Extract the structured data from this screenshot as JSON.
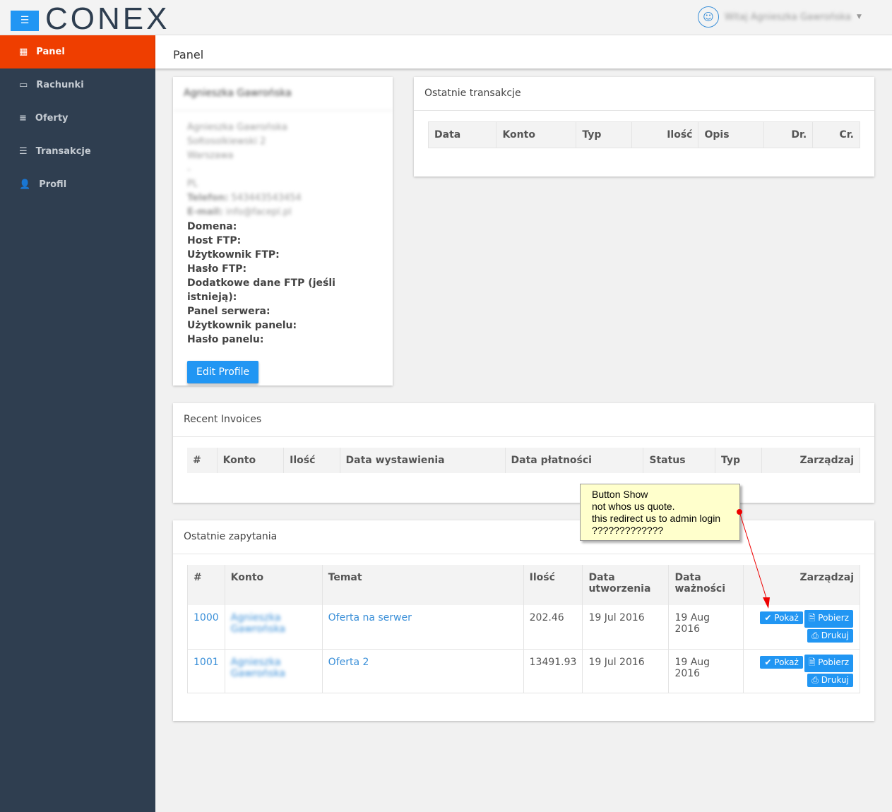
{
  "brand": "CONEX",
  "header": {
    "greeting": "Witaj Agnieszka Gawrońska"
  },
  "sidebar": {
    "items": [
      {
        "label": "Panel",
        "icon": "grid-icon"
      },
      {
        "label": "Rachunki",
        "icon": "card-icon"
      },
      {
        "label": "Oferty",
        "icon": "list-icon"
      },
      {
        "label": "Transakcje",
        "icon": "database-icon"
      },
      {
        "label": "Profil",
        "icon": "user-icon"
      }
    ]
  },
  "page_title": "Panel",
  "profile": {
    "name": "Agnieszka Gawrońska",
    "address": [
      "Agnieszka Gawrońska",
      "Sołtosolkiewski 2",
      "Warszawa",
      "-",
      "PL"
    ],
    "phone_label": "Telefon:",
    "phone": "543443543454",
    "email_label": "E-mail:",
    "email": "info@facepl.pl",
    "fields": [
      "Domena:",
      "Host FTP:",
      "Użytkownik FTP:",
      "Hasło FTP:",
      "Dodatkowe dane FTP (jeśli istnieją):",
      "Panel serwera:",
      "Użytkownik panelu:",
      "Hasło panelu:"
    ],
    "edit_button": "Edit Profile"
  },
  "transactions": {
    "title": "Ostatnie transakcje",
    "columns": [
      "Data",
      "Konto",
      "Typ",
      "Ilość",
      "Opis",
      "Dr.",
      "Cr."
    ]
  },
  "invoices": {
    "title": "Recent Invoices",
    "columns": [
      "#",
      "Konto",
      "Ilość",
      "Data wystawienia",
      "Data płatności",
      "Status",
      "Typ",
      "Zarządzaj"
    ]
  },
  "quotes": {
    "title": "Ostatnie zapytania",
    "columns": [
      "#",
      "Konto",
      "Temat",
      "Ilość",
      "Data utworzenia",
      "Data ważności",
      "Zarządzaj"
    ],
    "rows": [
      {
        "id": "1000",
        "account": "Agnieszka Gawrońska",
        "subject": "Oferta na serwer",
        "amount": "202.46",
        "created": "19 Jul 2016",
        "valid": "19 Aug 2016"
      },
      {
        "id": "1001",
        "account": "Agnieszka Gawrońska",
        "subject": "Oferta 2",
        "amount": "13491.93",
        "created": "19 Jul 2016",
        "valid": "19 Aug 2016"
      }
    ],
    "buttons": {
      "show": "Pokaż",
      "download": "Pobierz",
      "print": "Drukuj"
    }
  },
  "annotation": {
    "lines": [
      "Button Show",
      "not whos us quote.",
      "this redirect us to admin login",
      "?????????????"
    ]
  }
}
